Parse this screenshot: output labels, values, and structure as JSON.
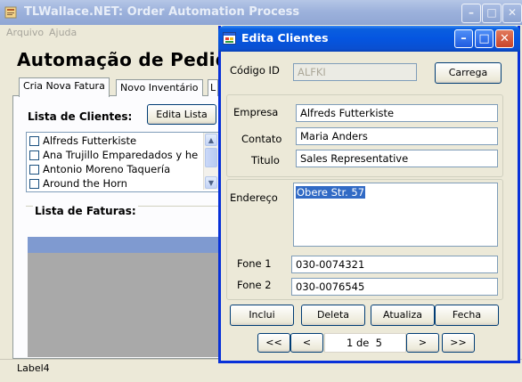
{
  "main_window": {
    "title": "TLWallace.NET: Order Automation Process",
    "menu": [
      "Arquivo",
      "Ajuda"
    ],
    "heading": "Automação de Pedido",
    "tabs": [
      "Cria Nova Fatura",
      "Novo Inventário",
      "L"
    ],
    "clients_label": "Lista de Clientes:",
    "edit_list_button": "Edita Lista",
    "clients": [
      "Alfreds Futterkiste",
      "Ana Trujillo Emparedados y he",
      "Antonio Moreno Taquería",
      "Around the Horn"
    ],
    "invoices_label": "Lista de Faturas:",
    "status_label": "Label4"
  },
  "dialog": {
    "title": "Edita Clientes",
    "codigo_label": "Código ID",
    "codigo_value": "ALFKI",
    "load_button": "Carrega",
    "empresa_label": "Empresa",
    "empresa_value": "Alfreds Futterkiste",
    "contato_label": "Contato",
    "contato_value": "Maria Anders",
    "titulo_label": "Titulo",
    "titulo_value": "Sales Representative",
    "endereco_label": "Endereço",
    "endereco_value": "Obere Str. 57",
    "fone1_label": "Fone 1",
    "fone1_value": "030-0074321",
    "fone2_label": "Fone 2",
    "fone2_value": "030-0076545",
    "buttons": [
      "Inclui",
      "Deleta",
      "Atualiza",
      "Fecha"
    ],
    "nav": {
      "first": "<<",
      "prev": "<",
      "page": "1 de  5",
      "next": ">",
      "last": ">>"
    }
  },
  "colors": {
    "dialog_title": "#0555e0",
    "selection": "#316ac5",
    "inactive_title": "#9db2dc"
  }
}
